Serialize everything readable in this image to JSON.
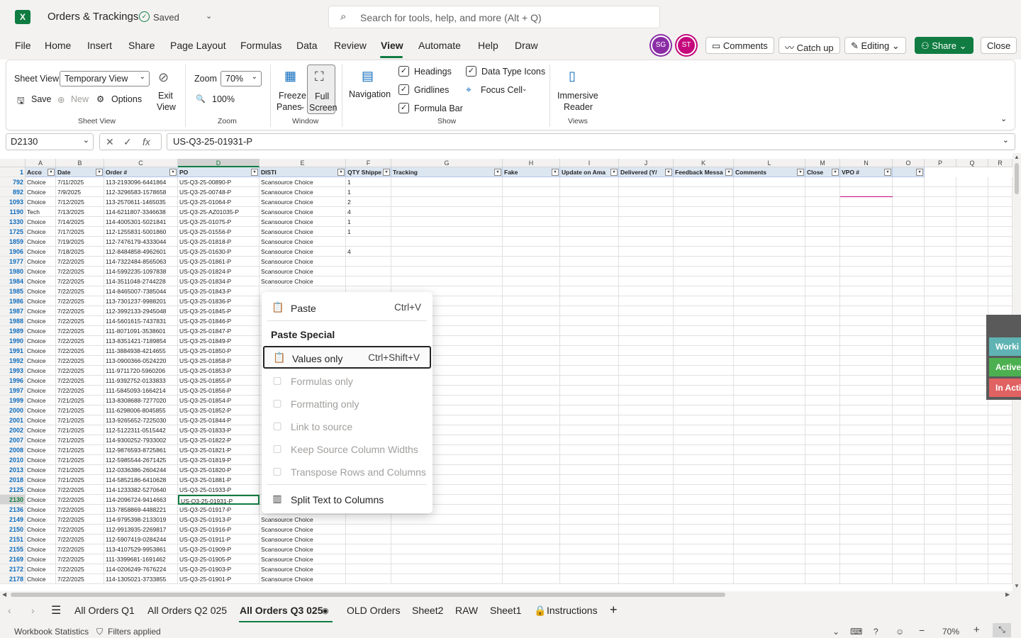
{
  "app": {
    "title": "Orders & Trackings",
    "saved": "Saved",
    "logo": "X",
    "search_placeholder": "Search for tools, help, and more (Alt + Q)"
  },
  "menu": [
    "File",
    "Home",
    "Insert",
    "Share",
    "Page Layout",
    "Formulas",
    "Data",
    "Review",
    "View",
    "Automate",
    "Help",
    "Draw"
  ],
  "menu_active": "View",
  "avatars": [
    {
      "initials": "SG",
      "color": "#8a2da5"
    },
    {
      "initials": "ST",
      "color": "#c5087c"
    }
  ],
  "top_buttons": {
    "comments": "Comments",
    "catchup": "Catch up",
    "editing": "Editing",
    "share": "Share",
    "close": "Close"
  },
  "ribbon": {
    "sheet_view_label": "Sheet View",
    "sheet_view_value": "Temporary View",
    "save": "Save",
    "new": "New",
    "options": "Options",
    "exit_view_1": "Exit",
    "exit_view_2": "View",
    "group_sheet_view": "Sheet View",
    "zoom_label": "Zoom",
    "zoom_value": "70%",
    "zoom_100": "100%",
    "group_zoom": "Zoom",
    "freeze_1": "Freeze",
    "freeze_2": "Panes",
    "full_1": "Full",
    "full_2": "Screen",
    "group_window": "Window",
    "navigation": "Navigation",
    "headings": "Headings",
    "gridlines": "Gridlines",
    "formula_bar": "Formula Bar",
    "data_type_icons": "Data Type Icons",
    "focus_cell": "Focus Cell",
    "group_show": "Show",
    "immersive_1": "Immersive",
    "immersive_2": "Reader",
    "group_views": "Views"
  },
  "formula": {
    "namebox": "D2130",
    "value": "US-Q3-25-01931-P"
  },
  "columns": [
    "A",
    "B",
    "C",
    "D",
    "E",
    "F",
    "G",
    "H",
    "I",
    "J",
    "K",
    "L",
    "M",
    "N",
    "O",
    "P",
    "Q",
    "R"
  ],
  "selected_column": "D",
  "header_row_number": "1",
  "table_headers": [
    "Acco",
    "Date",
    "Order #",
    "PO",
    "DISTI",
    "QTY Shippe",
    "Tracking",
    "Fake",
    "Update on Ama",
    "Delivered (Y/",
    "Feedback Messa",
    "Comments",
    "Close",
    "VPO #",
    ""
  ],
  "rows": [
    [
      "792",
      "Choice",
      "7/11/2025",
      "113-2193096-6441864",
      "US-Q3-25-00890-P",
      "Scansource Choice",
      "1"
    ],
    [
      "892",
      "Choice",
      "7/9/2025",
      "112-3296583-1578658",
      "US-Q3-25-00748-P",
      "Scansource Choice",
      "1"
    ],
    [
      "1093",
      "Choice",
      "7/12/2025",
      "113-2570611-1465035",
      "US-Q3-25-01064-P",
      "Scansource Choice",
      "2"
    ],
    [
      "1190",
      "Tech",
      "7/13/2025",
      "114-6211807-3346638",
      "US-Q3-25-AZ01035-P",
      "Scansource Choice",
      "4"
    ],
    [
      "1330",
      "Choice",
      "7/14/2025",
      "114-4005301-5021841",
      "US-Q3-25-01075-P",
      "Scansource Choice",
      "1"
    ],
    [
      "1725",
      "Choice",
      "7/17/2025",
      "112-1255831-5001860",
      "US-Q3-25-01556-P",
      "Scansource Choice",
      "1"
    ],
    [
      "1859",
      "Choice",
      "7/19/2025",
      "112-7476179-4333044",
      "US-Q3-25-01818-P",
      "Scansource Choice",
      ""
    ],
    [
      "1906",
      "Choice",
      "7/18/2025",
      "112-8484858-4962601",
      "US-Q3-25-01630-P",
      "Scansource Choice",
      "4"
    ],
    [
      "1977",
      "Choice",
      "7/22/2025",
      "114-7322484-8565063",
      "US-Q3-25-01861-P",
      "Scansource Choice",
      ""
    ],
    [
      "1980",
      "Choice",
      "7/22/2025",
      "114-5992235-1097838",
      "US-Q3-25-01824-P",
      "Scansource Choice",
      ""
    ],
    [
      "1984",
      "Choice",
      "7/22/2025",
      "114-3511048-2744228",
      "US-Q3-25-01834-P",
      "Scansource Choice",
      ""
    ],
    [
      "1985",
      "Choice",
      "7/22/2025",
      "114-8465007-7385044",
      "US-Q3-25-01843-P",
      "",
      ""
    ],
    [
      "1986",
      "Choice",
      "7/22/2025",
      "113-7301237-9988201",
      "US-Q3-25-01836-P",
      "",
      ""
    ],
    [
      "1987",
      "Choice",
      "7/22/2025",
      "112-3992133-2945048",
      "US-Q3-25-01845-P",
      "",
      ""
    ],
    [
      "1988",
      "Choice",
      "7/22/2025",
      "114-5601615-7437831",
      "US-Q3-25-01846-P",
      "",
      ""
    ],
    [
      "1989",
      "Choice",
      "7/22/2025",
      "111-8071091-3538601",
      "US-Q3-25-01847-P",
      "",
      ""
    ],
    [
      "1990",
      "Choice",
      "7/22/2025",
      "113-8351421-7189854",
      "US-Q3-25-01849-P",
      "",
      ""
    ],
    [
      "1991",
      "Choice",
      "7/22/2025",
      "111-3884938-4214655",
      "US-Q3-25-01850-P",
      "",
      ""
    ],
    [
      "1992",
      "Choice",
      "7/22/2025",
      "113-0900366-0524220",
      "US-Q3-25-01858-P",
      "",
      ""
    ],
    [
      "1993",
      "Choice",
      "7/22/2025",
      "111-9711720-5960206",
      "US-Q3-25-01853-P",
      "",
      ""
    ],
    [
      "1996",
      "Choice",
      "7/22/2025",
      "111-9392752-0133833",
      "US-Q3-25-01855-P",
      "",
      ""
    ],
    [
      "1997",
      "Choice",
      "7/22/2025",
      "111-5845093-1664214",
      "US-Q3-25-01856-P",
      "",
      ""
    ],
    [
      "1999",
      "Choice",
      "7/21/2025",
      "113-8308688-7277020",
      "US-Q3-25-01854-P",
      "",
      ""
    ],
    [
      "2000",
      "Choice",
      "7/21/2025",
      "111-6298006-8045855",
      "US-Q3-25-01852-P",
      "",
      ""
    ],
    [
      "2001",
      "Choice",
      "7/21/2025",
      "113-9265652-7225030",
      "US-Q3-25-01844-P",
      "",
      ""
    ],
    [
      "2002",
      "Choice",
      "7/21/2025",
      "112-5122311-0515442",
      "US-Q3-25-01833-P",
      "",
      ""
    ],
    [
      "2007",
      "Choice",
      "7/21/2025",
      "114-9300252-7933002",
      "US-Q3-25-01822-P",
      "",
      ""
    ],
    [
      "2008",
      "Choice",
      "7/21/2025",
      "112-9876593-8725861",
      "US-Q3-25-01821-P",
      "",
      ""
    ],
    [
      "2010",
      "Choice",
      "7/21/2025",
      "112-5985544-2671425",
      "US-Q3-25-01819-P",
      "",
      ""
    ],
    [
      "2013",
      "Choice",
      "7/21/2025",
      "112-0336386-2604244",
      "US-Q3-25-01820-P",
      "",
      ""
    ],
    [
      "2018",
      "Choice",
      "7/21/2025",
      "114-5852186-6410628",
      "US-Q3-25-01881-P",
      "",
      ""
    ],
    [
      "2125",
      "Choice",
      "7/22/2025",
      "114-1233382-5270640",
      "US-Q3-25-01933-P",
      "",
      ""
    ],
    [
      "2130",
      "Choice",
      "7/22/2025",
      "114-2096724-9414663",
      "US-Q3-25-01931-P",
      "",
      ""
    ],
    [
      "2136",
      "Choice",
      "7/22/2025",
      "113-7858869-4488221",
      "US-Q3-25-01917-P",
      "",
      ""
    ],
    [
      "2149",
      "Choice",
      "7/22/2025",
      "114-9795398-2133019",
      "US-Q3-25-01913-P",
      "Scansource Choice",
      ""
    ],
    [
      "2150",
      "Choice",
      "7/22/2025",
      "112-9913935-2269817",
      "US-Q3-25-01916-P",
      "Scansource Choice",
      ""
    ],
    [
      "2151",
      "Choice",
      "7/22/2025",
      "112-5907419-0284244",
      "US-Q3-25-01911-P",
      "Scansource Choice",
      ""
    ],
    [
      "2155",
      "Choice",
      "7/22/2025",
      "113-4107529-9953861",
      "US-Q3-25-01909-P",
      "Scansource Choice",
      ""
    ],
    [
      "2169",
      "Choice",
      "7/22/2025",
      "111-3399681-1691462",
      "US-Q3-25-01905-P",
      "Scansource Choice",
      ""
    ],
    [
      "2172",
      "Choice",
      "7/22/2025",
      "114-0206249-7676224",
      "US-Q3-25-01903-P",
      "Scansource Choice",
      ""
    ],
    [
      "2178",
      "Choice",
      "7/22/2025",
      "114-1305021-3733855",
      "US-Q3-25-01901-P",
      "Scansource Choice",
      ""
    ]
  ],
  "active_row": "2130",
  "context_menu": {
    "paste": "Paste",
    "paste_short": "Ctrl+V",
    "paste_special": "Paste Special",
    "values_only": "Values only",
    "values_short": "Ctrl+Shift+V",
    "formulas_only": "Formulas only",
    "formatting_only": "Formatting only",
    "link_to_source": "Link to source",
    "keep_widths": "Keep Source Column Widths",
    "transpose": "Transpose Rows and Columns",
    "split_text": "Split Text to Columns"
  },
  "side_panel": [
    {
      "label": "Worki",
      "color": "#5fb3b3"
    },
    {
      "label": "Active",
      "color": "#4caf50"
    },
    {
      "label": "In Acti",
      "color": "#e06262"
    }
  ],
  "sheet_tabs": [
    "All Orders Q1",
    "All Orders Q2 025",
    "All Orders Q3 025",
    "OLD Orders",
    "Sheet2",
    "RAW",
    "Sheet1",
    "Instructions"
  ],
  "active_tab": "All Orders Q3 025",
  "status": {
    "workbook_stats": "Workbook Statistics",
    "filters": "Filters applied",
    "zoom": "70%"
  }
}
